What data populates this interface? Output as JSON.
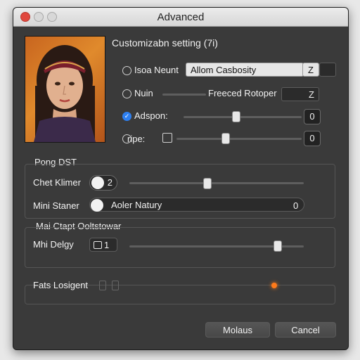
{
  "window": {
    "title": "Advanced"
  },
  "section_main": {
    "title": "Customizabn setting (7i)"
  },
  "rows": [
    {
      "label": "Isoa Neunt",
      "field": "Allom Casbosity",
      "field_end": "Z"
    },
    {
      "label": "Nuin",
      "field": "Freeced Rotoper",
      "field_end": "Z"
    },
    {
      "label": "Adspon:",
      "value": "0"
    },
    {
      "label": "ripe:",
      "value": "0"
    }
  ],
  "section_pong": {
    "title": "Pong DST",
    "chet_label": "Chet Klimer",
    "chet_toggle_value": "2",
    "mini_label": "Mini Staner",
    "mini_field": "Aoler Natury",
    "mini_value": "0"
  },
  "section_mai": {
    "title": "Mai Ctapt Ooltstowar",
    "mhi_label": "Mhi Delgy",
    "mhi_toggle_value": "1"
  },
  "section_fats": {
    "label": "Fats Losigent"
  },
  "buttons": {
    "ok": "Molaus",
    "cancel": "Cancel"
  }
}
